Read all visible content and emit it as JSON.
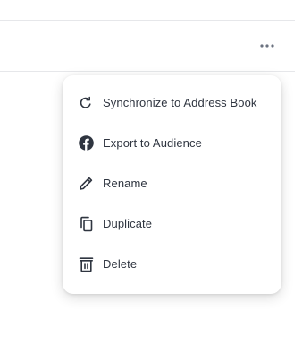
{
  "header": {
    "more_icon": "more-horizontal-icon"
  },
  "menu": {
    "items": [
      {
        "label": "Synchronize to Address Book",
        "icon": "sync-icon"
      },
      {
        "label": "Export to Audience",
        "icon": "facebook-icon"
      },
      {
        "label": "Rename",
        "icon": "pencil-icon"
      },
      {
        "label": "Duplicate",
        "icon": "copy-icon"
      },
      {
        "label": "Delete",
        "icon": "trash-icon"
      }
    ]
  },
  "colors": {
    "text": "#2f3540",
    "icon": "#2f3540",
    "divider": "#e6e7ea",
    "more_dots": "#6b7280"
  }
}
